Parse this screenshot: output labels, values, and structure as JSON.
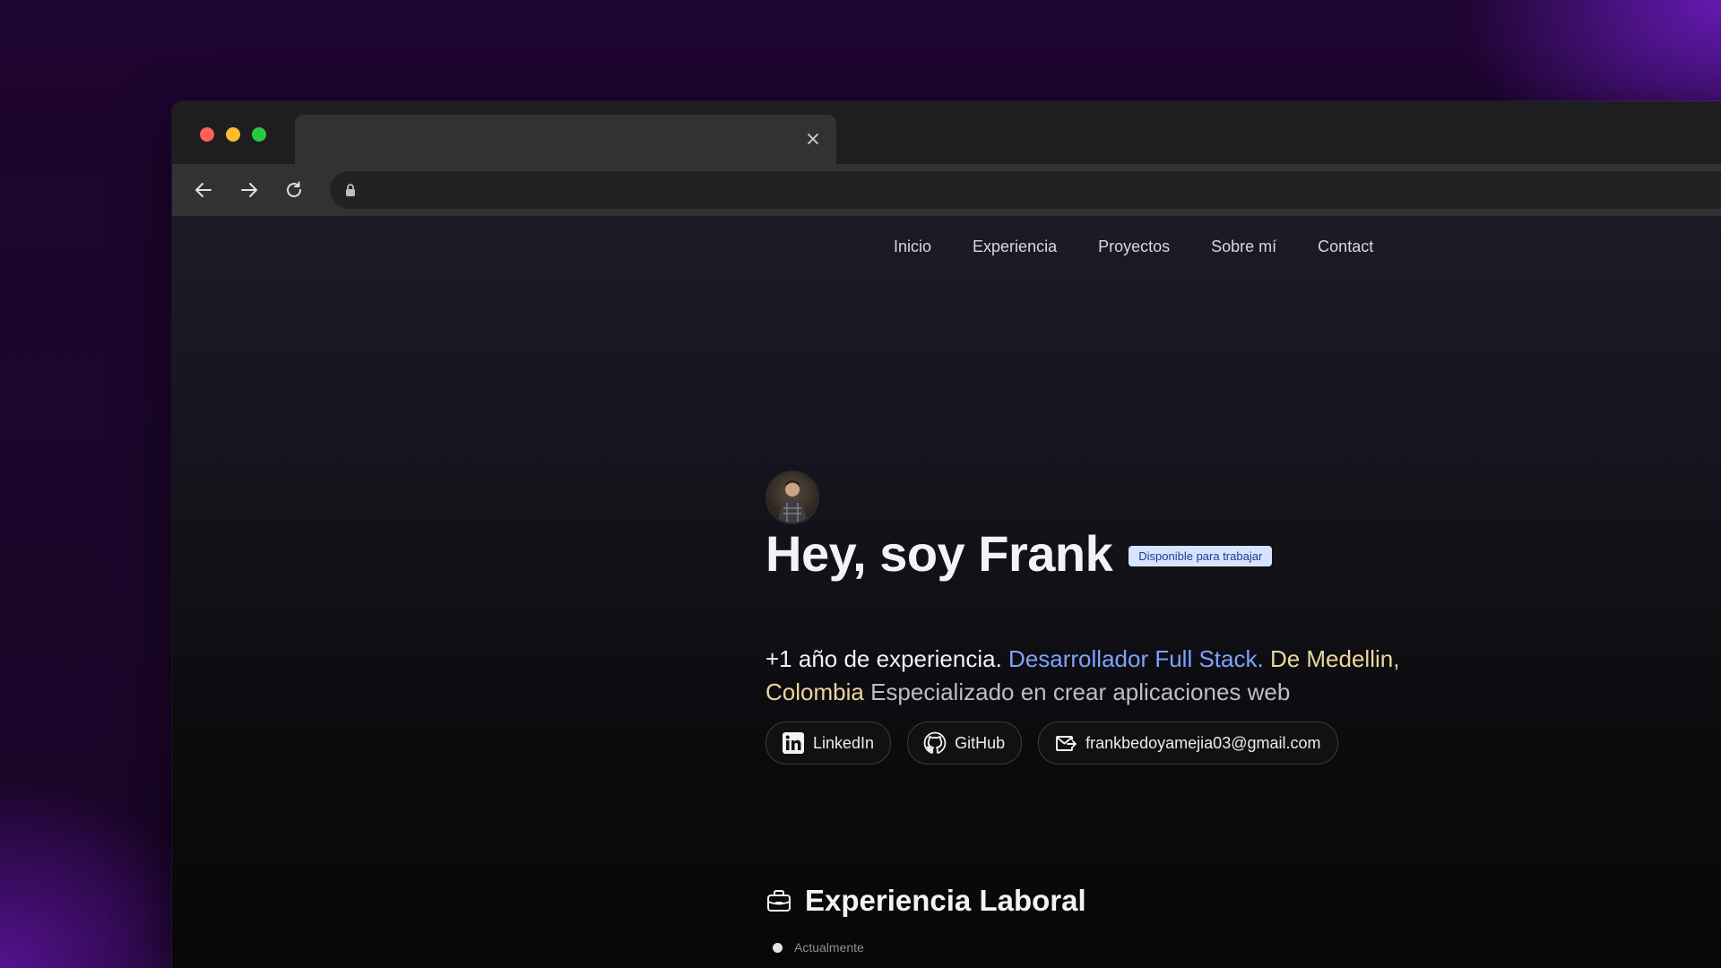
{
  "colors": {
    "background": "#1a0629",
    "accent_purple": "#701ec8",
    "role_text": "#7da2ff",
    "location_text": "#ead79b",
    "badge_bg": "#d6e4ff",
    "badge_text": "#1d3c8f"
  },
  "browser": {
    "tab": {
      "title": "",
      "close_icon": "close-icon"
    },
    "toolbar": {
      "back_icon": "arrow-left-icon",
      "forward_icon": "arrow-right-icon",
      "reload_icon": "reload-icon",
      "address": {
        "lock_icon": "lock-icon",
        "url": ""
      }
    }
  },
  "site": {
    "nav": [
      "Inicio",
      "Experiencia",
      "Proyectos",
      "Sobre mí",
      "Contact"
    ],
    "hero": {
      "avatar": "avatar-photo",
      "title": "Hey, soy Frank",
      "badge": "Disponible para trabajar",
      "description": {
        "lead": "+1 año de experiencia.",
        "role": "Desarrollador Full Stack.",
        "place": "De Medellin, Colombia",
        "rest": "Especializado en crear aplicaciones web"
      },
      "socials": [
        {
          "label": "LinkedIn",
          "icon": "linkedin-icon"
        },
        {
          "label": "GitHub",
          "icon": "github-icon"
        },
        {
          "label": "frankbedoyamejia03@gmail.com",
          "icon": "mail-icon"
        }
      ]
    },
    "experience": {
      "icon": "briefcase-icon",
      "title": "Experiencia Laboral",
      "first_item_label": "Actualmente"
    }
  }
}
